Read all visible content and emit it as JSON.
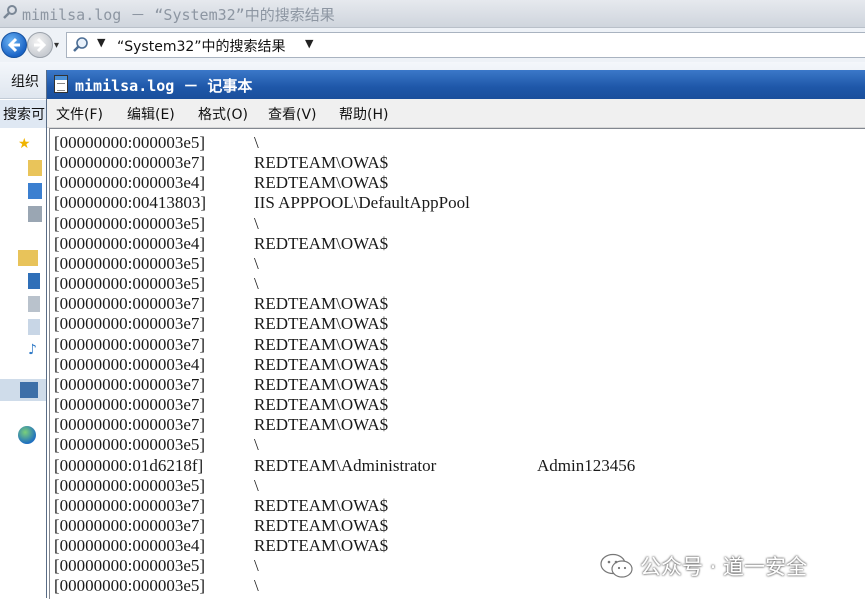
{
  "explorer": {
    "window_title": "mimilsa.log － “System32”中的搜索结果",
    "address_text": "“System32”中的搜索结果",
    "organize_label": "组织",
    "search_label": "搜索可"
  },
  "notepad": {
    "title": "mimilsa.log － 记事本",
    "menu": [
      "文件(F)",
      "编辑(E)",
      "格式(O)",
      "查看(V)",
      "帮助(H)"
    ],
    "lines": [
      {
        "id": "[00000000:000003e5]",
        "user": "\\",
        "password": ""
      },
      {
        "id": "[00000000:000003e7]",
        "user": "REDTEAM\\OWA$",
        "password": ""
      },
      {
        "id": "[00000000:000003e4]",
        "user": "REDTEAM\\OWA$",
        "password": ""
      },
      {
        "id": "[00000000:00413803]",
        "user": "IIS APPPOOL\\DefaultAppPool",
        "password": ""
      },
      {
        "id": "[00000000:000003e5]",
        "user": "\\",
        "password": ""
      },
      {
        "id": "[00000000:000003e4]",
        "user": "REDTEAM\\OWA$",
        "password": ""
      },
      {
        "id": "[00000000:000003e5]",
        "user": "\\",
        "password": ""
      },
      {
        "id": "[00000000:000003e5]",
        "user": "\\",
        "password": ""
      },
      {
        "id": "[00000000:000003e7]",
        "user": "REDTEAM\\OWA$",
        "password": ""
      },
      {
        "id": "[00000000:000003e7]",
        "user": "REDTEAM\\OWA$",
        "password": ""
      },
      {
        "id": "[00000000:000003e7]",
        "user": "REDTEAM\\OWA$",
        "password": ""
      },
      {
        "id": "[00000000:000003e4]",
        "user": "REDTEAM\\OWA$",
        "password": ""
      },
      {
        "id": "[00000000:000003e7]",
        "user": "REDTEAM\\OWA$",
        "password": ""
      },
      {
        "id": "[00000000:000003e7]",
        "user": "REDTEAM\\OWA$",
        "password": ""
      },
      {
        "id": "[00000000:000003e7]",
        "user": "REDTEAM\\OWA$",
        "password": ""
      },
      {
        "id": "[00000000:000003e5]",
        "user": "\\",
        "password": ""
      },
      {
        "id": "[00000000:01d6218f]",
        "user": "REDTEAM\\Administrator",
        "password": "Admin123456"
      },
      {
        "id": "[00000000:000003e5]",
        "user": "\\",
        "password": ""
      },
      {
        "id": "[00000000:000003e7]",
        "user": "REDTEAM\\OWA$",
        "password": ""
      },
      {
        "id": "[00000000:000003e7]",
        "user": "REDTEAM\\OWA$",
        "password": ""
      },
      {
        "id": "[00000000:000003e4]",
        "user": "REDTEAM\\OWA$",
        "password": ""
      },
      {
        "id": "[00000000:000003e5]",
        "user": "\\",
        "password": ""
      },
      {
        "id": "[00000000:000003e5]",
        "user": "\\",
        "password": ""
      }
    ]
  },
  "watermark": {
    "text": "公众号 · 道一安全"
  },
  "icons": {
    "explorer_app": "search-folder-icon",
    "back": "back-arrow-icon",
    "forward": "forward-arrow-icon",
    "search": "search-magnifier-icon",
    "notepad_app": "notepad-icon",
    "watermark": "wechat-icon"
  },
  "colors": {
    "notepad_titlebar": "#1e57a8",
    "back_button": "#1b64c6"
  }
}
